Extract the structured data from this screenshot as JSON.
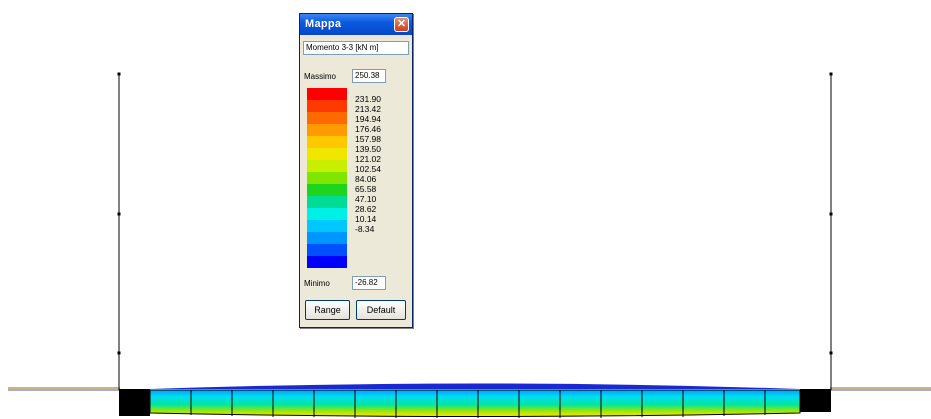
{
  "window": {
    "title": "Mappa",
    "close_glyph": "✕",
    "quantity": "Momento 3-3 [kN  m]",
    "max_label": "Massimo",
    "max_value": "250.38",
    "min_label": "Minimo",
    "min_value": "-26.82",
    "range_button": "Range",
    "default_button": "Default"
  },
  "scale": {
    "ticks": [
      "231.90",
      "213.42",
      "194.94",
      "176.46",
      "157.98",
      "139.50",
      "121.02",
      "102.54",
      "84.06",
      "65.58",
      "47.10",
      "28.62",
      "10.14",
      "-8.34"
    ],
    "colors": [
      "#ff0000",
      "#ff3a00",
      "#ff6a00",
      "#ff9a00",
      "#ffc800",
      "#f0e600",
      "#c8ee00",
      "#80e600",
      "#1ed41e",
      "#00dc96",
      "#00f0e6",
      "#00c8ff",
      "#0096ff",
      "#0050ff",
      "#0000ff"
    ]
  },
  "colors": {
    "frame_line": "#000000",
    "support_block": "#000000",
    "beam_low": "#ffe400",
    "beam_mid": "#00e6b4",
    "beam_high": "#00a0ff",
    "beam_top_band": "#0000c8"
  }
}
